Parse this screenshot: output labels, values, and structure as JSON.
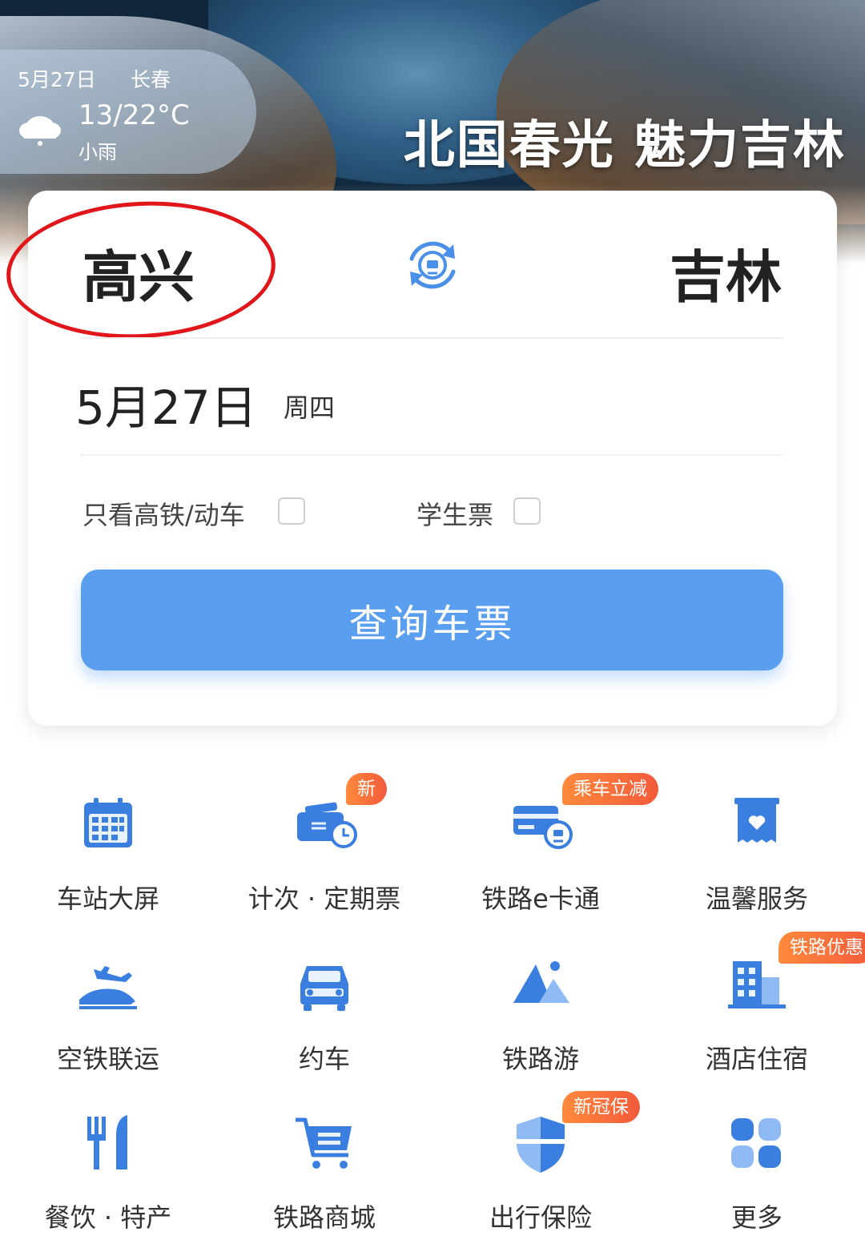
{
  "banner": {
    "title": "北国春光 魅力吉林"
  },
  "weather": {
    "date": "5月27日",
    "city": "长春",
    "temperature": "13/22°C",
    "condition": "小雨",
    "icon": "cloud-rain-icon"
  },
  "search": {
    "from_station": "高兴",
    "to_station": "吉林",
    "date": "5月27日",
    "weekday": "周四",
    "option_highspeed": "只看高铁/动车",
    "option_student": "学生票",
    "button_label": "查询车票"
  },
  "services": [
    {
      "label": "车站大屏",
      "icon": "calendar-icon",
      "badge": ""
    },
    {
      "label": "计次 · 定期票",
      "icon": "ticket-clock-icon",
      "badge": "新"
    },
    {
      "label": "铁路e卡通",
      "icon": "card-icon",
      "badge": "乘车立减"
    },
    {
      "label": "温馨服务",
      "icon": "heart-box-icon",
      "badge": ""
    },
    {
      "label": "空铁联运",
      "icon": "plane-train-icon",
      "badge": ""
    },
    {
      "label": "约车",
      "icon": "car-icon",
      "badge": ""
    },
    {
      "label": "铁路游",
      "icon": "mountain-icon",
      "badge": ""
    },
    {
      "label": "酒店住宿",
      "icon": "hotel-icon",
      "badge": "铁路优惠"
    },
    {
      "label": "餐饮 · 特产",
      "icon": "fork-knife-icon",
      "badge": ""
    },
    {
      "label": "铁路商城",
      "icon": "cart-icon",
      "badge": ""
    },
    {
      "label": "出行保险",
      "icon": "shield-icon",
      "badge": "新冠保"
    },
    {
      "label": "更多",
      "icon": "grid-more-icon",
      "badge": ""
    }
  ],
  "colors": {
    "accent": "#4a8fe8",
    "button": "#5a9ef0",
    "badge": "#f4663d",
    "annotation": "#e0161b"
  }
}
